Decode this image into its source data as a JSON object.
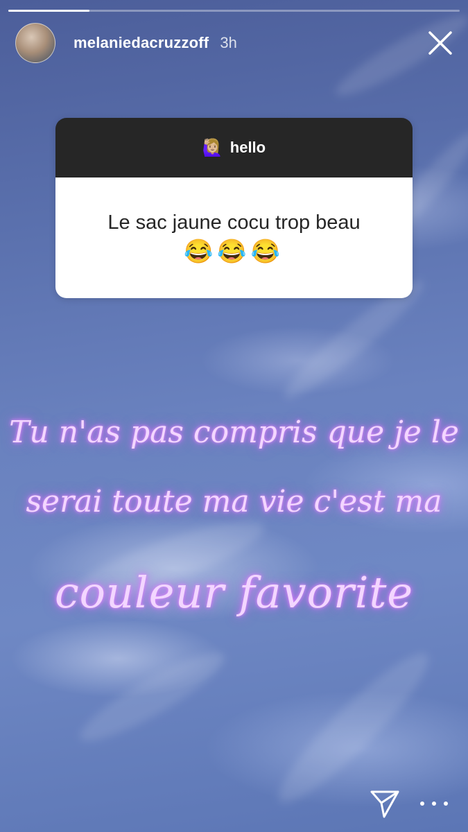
{
  "story": {
    "progress": 0.18,
    "colors": {
      "sky_top": "#4c5e9a",
      "sky_bottom": "#6f88c4",
      "neon_text": "#f3d6ff",
      "card_header": "#262626"
    }
  },
  "header": {
    "username": "melaniedacruzzoff",
    "time": "3h",
    "avatar_icon": "profile-photo",
    "close_icon": "close-icon"
  },
  "question_card": {
    "emoji": "🙋🏼‍♀️",
    "prompt": "hello",
    "answer": "Le sac jaune cocu trop beau",
    "answer_emojis": "😂😂😂"
  },
  "overlay_text": {
    "line1": "Tu n'as pas compris que je le",
    "line2": "serai toute ma vie c'est ma",
    "line3": "couleur favorite"
  },
  "footer": {
    "send_icon": "send-icon",
    "more_icon": "more-icon"
  }
}
